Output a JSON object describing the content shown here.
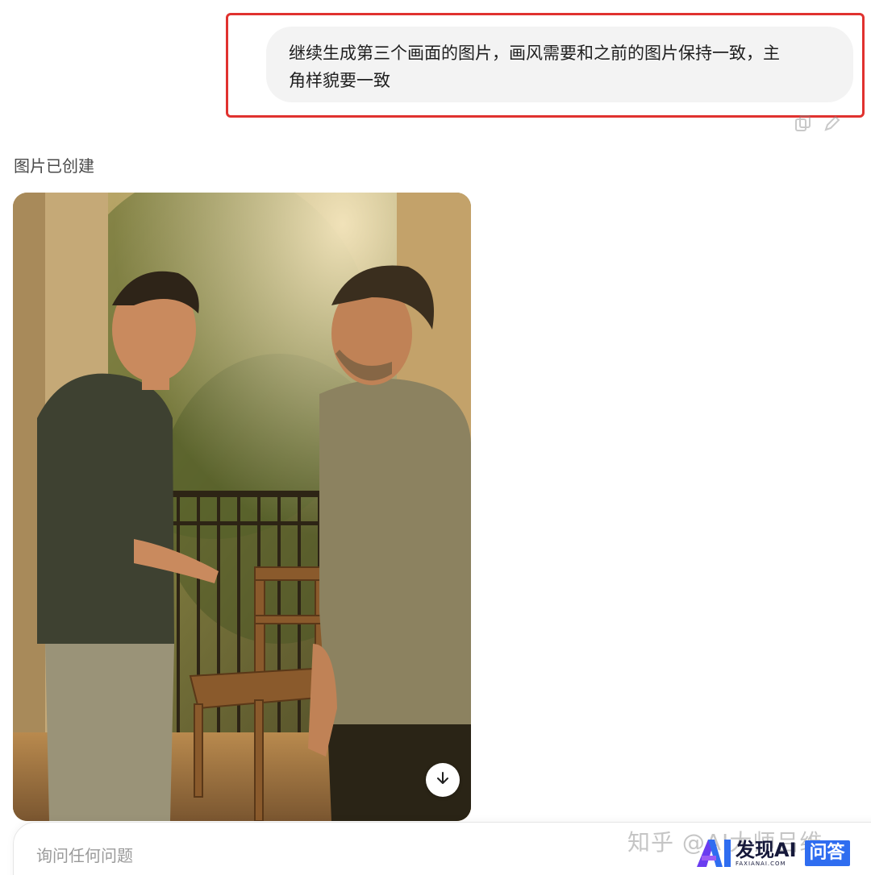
{
  "user_message": {
    "line1": "继续生成第三个画面的图片，画风需要和之前的图片保持一致，主",
    "line2": "角样貌要一致"
  },
  "assistant": {
    "status": "图片已创建"
  },
  "composer": {
    "placeholder": "询问任何问题"
  },
  "watermarks": {
    "zhihu": "知乎 @AI大师吕维",
    "logo_main": "发现AI",
    "logo_sub": "FAXIANAI.COM",
    "logo_badge": "问答"
  },
  "icons": [
    "copy-icon",
    "edit-icon",
    "download-arrow-icon"
  ],
  "colors": {
    "highlight_border": "#e0322f",
    "bubble_bg": "#f3f3f3",
    "logo_badge": "#2f6df0"
  }
}
